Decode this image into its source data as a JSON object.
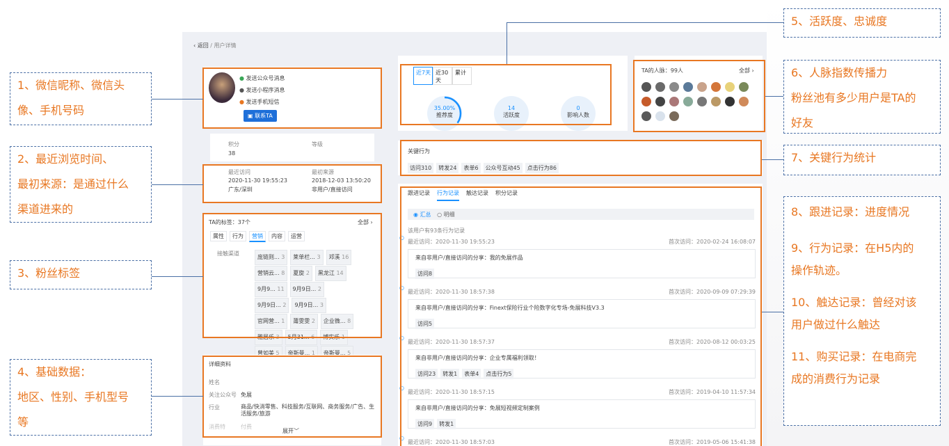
{
  "breadcrumb": {
    "back": "返回",
    "sep": "/",
    "page": "用户详情"
  },
  "profile": {
    "actions": [
      "发送公众号消息",
      "发送小程序消息",
      "发送手机短信"
    ],
    "contact_btn": "联系TA"
  },
  "points": {
    "label": "积分",
    "value": "38",
    "level_label": "等级"
  },
  "visit": {
    "recent_label": "最近访问",
    "recent_time": "2020-11-30 19:55:23",
    "location": "广东/深圳",
    "source_label": "最初来源",
    "source_time": "2018-12-03 13:50:20",
    "source": "非用户/直接访问"
  },
  "tags": {
    "title": "TA的标签：37个",
    "all": "全部",
    "tabs": [
      "属性",
      "行为",
      "营销",
      "内容",
      "运营"
    ],
    "row_label": "接触渠道",
    "items": [
      [
        "庞链则...",
        "3"
      ],
      [
        "莱单栏...",
        "3"
      ],
      [
        "邓溪",
        "16"
      ],
      [
        "营销云...",
        "8"
      ],
      [
        "夏旋",
        "2"
      ],
      [
        "黑龙江",
        "14"
      ],
      [
        "9月9...",
        "11"
      ],
      [
        "9月9日...",
        "2"
      ],
      [
        "9月9日...",
        "2"
      ],
      [
        "9月9日...",
        "3"
      ],
      [
        "官网营...",
        "1"
      ],
      [
        "莆雯雯",
        "2"
      ],
      [
        "企业微...",
        "8"
      ],
      [
        "雅居乐",
        "3"
      ],
      [
        "5月31...",
        "6"
      ],
      [
        "博实乐",
        "1"
      ],
      [
        "曾如美",
        "5"
      ],
      [
        "帝斯曼...",
        "1"
      ],
      [
        "帝斯曼...",
        "5"
      ],
      [
        "2.14公...",
        "2"
      ],
      [
        "陈庭立",
        "125"
      ]
    ]
  },
  "details": {
    "title": "详细资料",
    "rows": [
      [
        "姓名",
        ""
      ],
      [
        "关注公众号",
        "免展"
      ],
      [
        "行业",
        "商品/快消零售、科技服务/互联网、商务服务/广告、生活服务/旅游"
      ],
      [
        "消费特",
        "付费"
      ]
    ],
    "expand": "展开"
  },
  "activity": {
    "tabs": [
      "近7天",
      "近30天",
      "累计"
    ],
    "metrics": [
      [
        "35.00%",
        "推荐度"
      ],
      [
        "14",
        "活跃度"
      ],
      [
        "0",
        "影响人数"
      ]
    ],
    "recommend_pct": 35
  },
  "network": {
    "title": "TA的人脉：99人",
    "all": "全部",
    "avatar_colors": [
      "#555",
      "#6a6a6a",
      "#8a8a8a",
      "#5b7a99",
      "#c9a38b",
      "#d4763a",
      "#e8d27a",
      "#7a8a5a",
      "#c65b2a",
      "#444",
      "#a77",
      "#8a9",
      "#777",
      "#b96",
      "#333",
      "#d08a5a",
      "#5a5a5a",
      "#d9e2ec",
      "#7a6a5a"
    ]
  },
  "key_actions": {
    "title": "关键行为",
    "items": [
      "访问310",
      "转发24",
      "表单6",
      "公众号互动45",
      "点击行为86"
    ]
  },
  "records": {
    "tabs": [
      "跟进记录",
      "行为记录",
      "触达记录",
      "积分记录"
    ],
    "filters": [
      "汇总",
      "明细"
    ],
    "summary": "该用户有93条行为记录",
    "items": [
      {
        "recent": "最近访问：2020-11-30 19:55:23",
        "first": "首次访问：2020-02-24 16:08:07",
        "share": "来自非用户/直接访问的分享：我的免展作品",
        "chips": [
          "访问8"
        ]
      },
      {
        "recent": "最近访问：2020-11-30 18:57:38",
        "first": "首次访问：2020-09-09 07:29:39",
        "share": "来自非用户/直接访问的分享：Finext保险行业个险数字化专场-免展科技V3.3",
        "chips": [
          "访问5"
        ]
      },
      {
        "recent": "最近访问：2020-11-30 18:57:37",
        "first": "首次访问：2020-08-12 00:03:25",
        "share": "来自非用户/直接访问的分享：企业专属福利领取！",
        "chips": [
          "访问23",
          "转发1",
          "表单4",
          "点击行为5"
        ]
      },
      {
        "recent": "最近访问：2020-11-30 18:57:15",
        "first": "首次访问：2019-04-10 11:57:34",
        "share": "来自非用户/直接访问的分享：免展短视频定制案例",
        "chips": [
          "访问9",
          "转发1"
        ]
      },
      {
        "recent": "最近访问：2020-11-30 18:57:03",
        "first": "首次访问：2019-05-06 15:41:38",
        "share": "",
        "chips": []
      }
    ]
  },
  "notes": {
    "n1": [
      "1、微信昵称、微信头",
      "像、手机号码"
    ],
    "n2": [
      "2、最近浏览时间、",
      "最初来源：是通过什么",
      "渠道进来的"
    ],
    "n3": [
      "3、粉丝标签"
    ],
    "n4": [
      "4、基础数据：",
      "地区、性别、手机型号",
      "等"
    ],
    "n5": [
      "5、活跃度、忠诚度"
    ],
    "n6": [
      "6、人脉指数传播力",
      "粉丝池有多少用户是TA的",
      "好友"
    ],
    "n7": [
      "7、关键行为统计"
    ],
    "n8": [
      "8、跟进记录：进度情况",
      "",
      "9、行为记录：在H5内的",
      "操作轨迹。",
      "",
      "10、触达记录：曾经对该",
      "用户做过什么触达",
      "",
      "11、购买记录：在电商完",
      "成的消费行为记录"
    ]
  },
  "colors": {
    "accent": "#1890ff",
    "orange": "#e87722",
    "note_border": "#4a6fa5"
  }
}
